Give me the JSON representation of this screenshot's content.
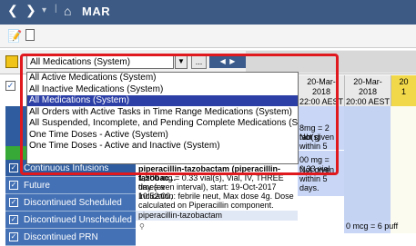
{
  "window": {
    "title": "MAR"
  },
  "filter": {
    "selected": "All Medications (System)",
    "ellipsis_label": "..."
  },
  "dropdown_options": [
    "All Active Medications (System)",
    "All Inactive Medications (System)",
    "All Medications (System)",
    "All Orders with Active Tasks in Time Range Medications (System)",
    "All Suspended, Incomplete, and Pending Complete Medications (System)",
    "One Time Doses - Active (System)",
    "One Time Doses - Active and Inactive (System)"
  ],
  "dropdown_selected_index": 2,
  "columns": [
    {
      "date": "20-Mar-2018",
      "time": "22:00 AEST"
    },
    {
      "date": "20-Mar-2018",
      "time": "20:00 AEST"
    },
    {
      "date": "20",
      "time": "1"
    }
  ],
  "nav_items": [
    {
      "label": "Continuous Infusions"
    },
    {
      "label": "Future"
    },
    {
      "label": "Discontinued Scheduled"
    },
    {
      "label": "Discontinued Unscheduled"
    },
    {
      "label": "Discontinued PRN"
    }
  ],
  "cells": {
    "top_dose": "8mg = 2 tab(s)",
    "top_status_1": "Not given",
    "top_status_2": "within 5 days.",
    "mid_dose": "00 mg = 0.33 vial",
    "mid_status_1": "Not given",
    "mid_status_2": "within 5 days.",
    "bottom_dose": "0 mcg = 6 puff",
    "order_text": [
      "piperacillin-tazobactam (piperacillin-tazobac...",
      "1,500 mg = 0.33 vial(s), Vial, IV, THREE times a",
      "day (even interval), start: 19-Oct-2017 10:52:00,",
      "Indication: febrile neut, Max dose 4g. Dose",
      "calculated on Piperacillin component."
    ],
    "order_name": "piperacillin-tazobactam"
  }
}
